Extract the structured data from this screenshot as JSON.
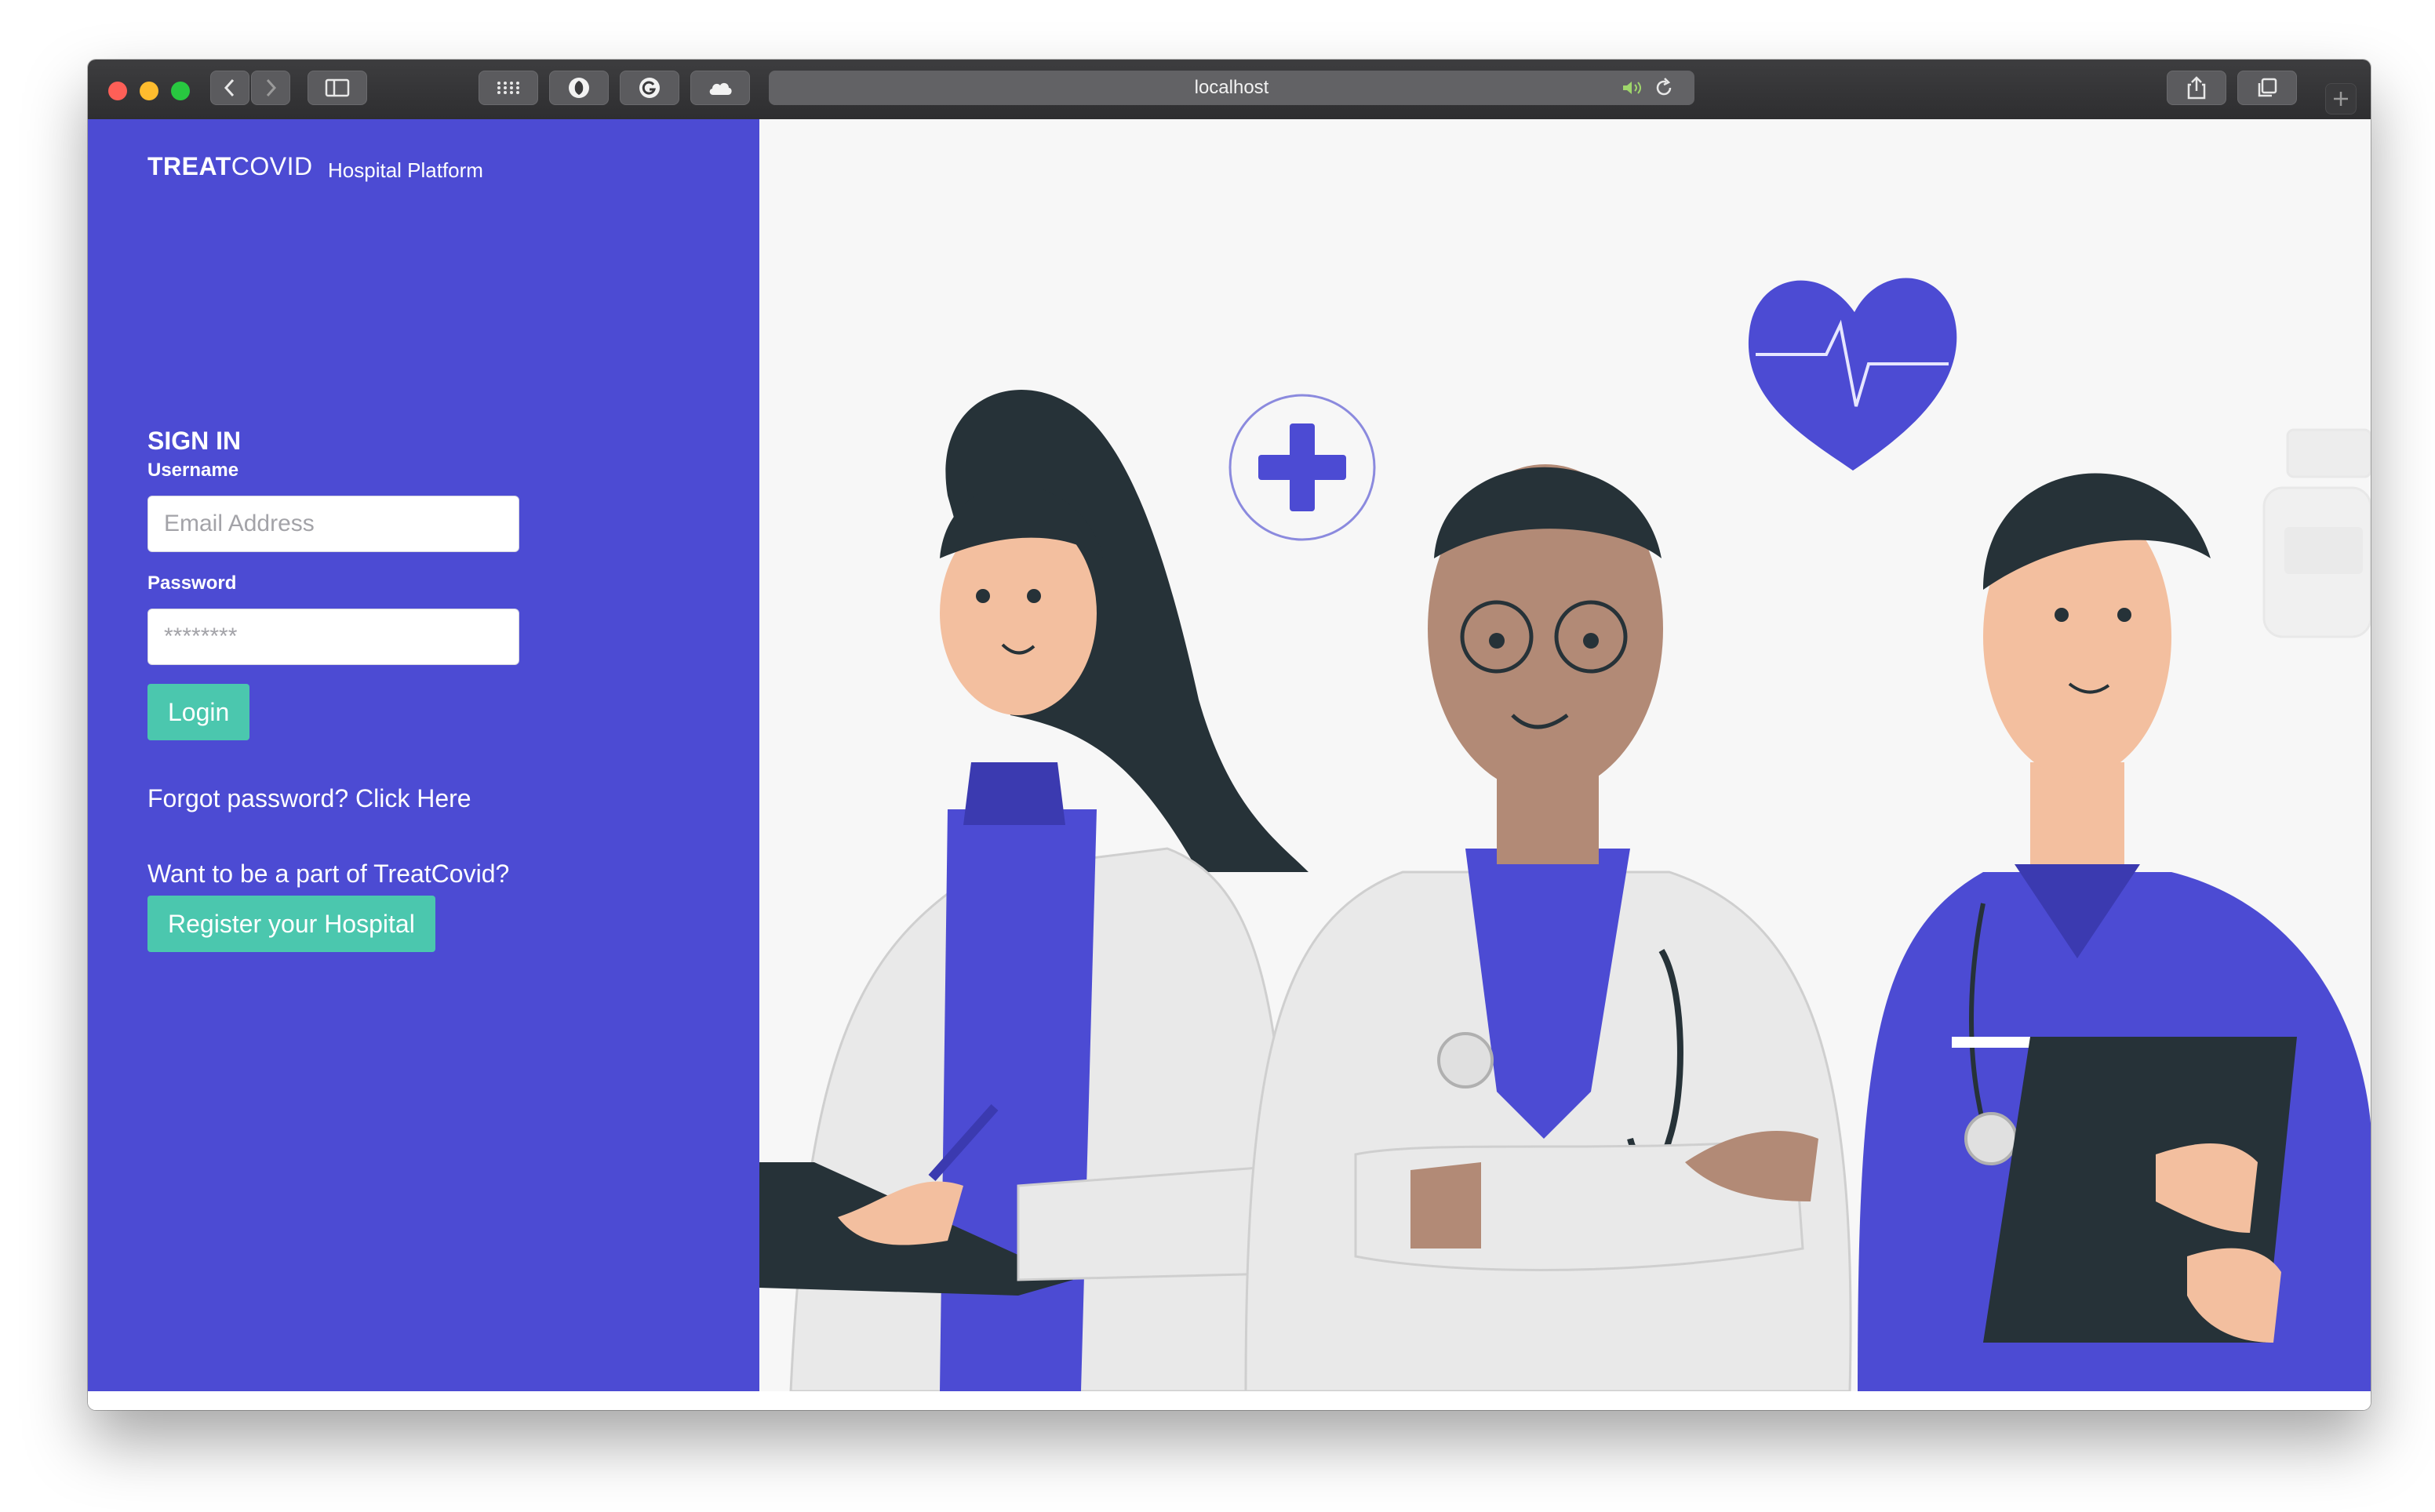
{
  "browser": {
    "url": "localhost",
    "buttons": [
      "back",
      "forward",
      "sidebar",
      "top-sites",
      "extension-1",
      "grammarly",
      "cloud",
      "share",
      "tabs",
      "new-tab"
    ]
  },
  "brand": {
    "bold": "TREAT",
    "regular": "COVID",
    "subtitle": "Hospital Platform"
  },
  "form": {
    "heading": "SIGN IN",
    "username_label": "Username",
    "username_placeholder": "Email Address",
    "password_label": "Password",
    "password_placeholder": "********",
    "login_button": "Login"
  },
  "links": {
    "forgot": "Forgot password? Click Here",
    "join_prompt": "Want to be a part of TreatCovid?",
    "register_button": "Register your Hospital"
  },
  "colors": {
    "sidebar": "#4c4bd3",
    "accent": "#4bc7ae",
    "scrubs": "#4c4bd3",
    "skin_light": "#f3bf9f",
    "skin_dark": "#b28a76",
    "hair": "#263238"
  }
}
